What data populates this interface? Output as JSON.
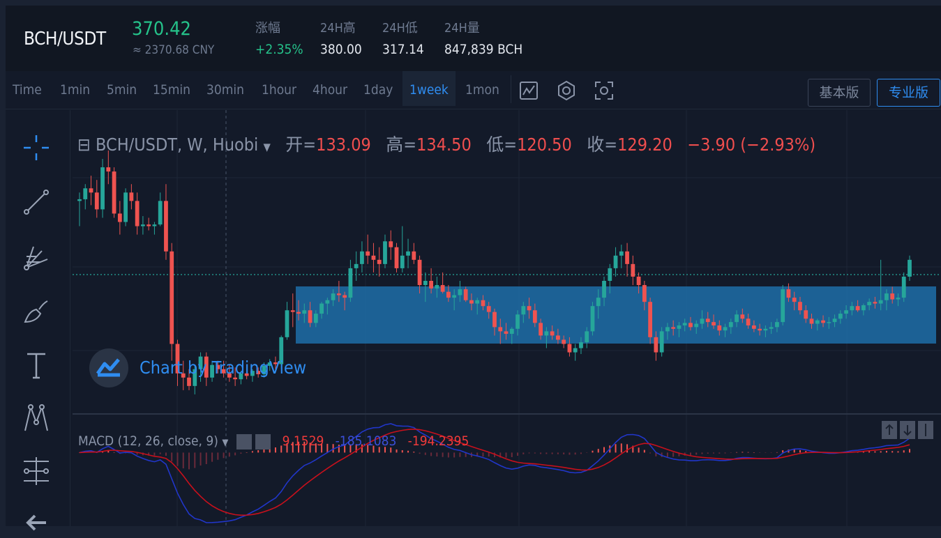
{
  "ticker": {
    "symbol": "BCH/USDT",
    "price": "370.42",
    "price_cny": "≈ 2370.68 CNY",
    "stats": [
      {
        "label": "涨幅",
        "value": "+2.35%",
        "up": true
      },
      {
        "label": "24H高",
        "value": "380.00"
      },
      {
        "label": "24H低",
        "value": "317.14"
      },
      {
        "label": "24H量",
        "value": "847,839 BCH"
      }
    ]
  },
  "toolbar": {
    "timeframes": [
      "Time",
      "1min",
      "5min",
      "15min",
      "30min",
      "1hour",
      "4hour",
      "1day",
      "1week",
      "1mon"
    ],
    "active_timeframe": "1week",
    "icons": [
      "indicator-icon",
      "settings-icon",
      "screenshot-icon"
    ],
    "basic_label": "基本版",
    "pro_label": "专业版",
    "active_version": "专业版"
  },
  "drawing_tools": [
    "crosshair-icon",
    "trend-line-icon",
    "fib-fan-icon",
    "brush-icon",
    "text-icon",
    "pattern-icon",
    "measure-icon",
    "back-arrow-icon"
  ],
  "legend": {
    "title": "BCH/USDT, W, Huobi",
    "open_label": "开=",
    "open": "133.09",
    "high_label": "高=",
    "high": "134.50",
    "low_label": "低=",
    "low": "120.50",
    "close_label": "收=",
    "close": "129.20",
    "change": "−3.90 (−2.93%)"
  },
  "watermark": "Chart by TradingView",
  "macd": {
    "label": "MACD (12, 26, close, 9)",
    "histogram": "9.1529",
    "macd": "-185.1083",
    "signal": "-194.2395"
  },
  "colors": {
    "up": "#26a69a",
    "down": "#ef5350",
    "accent": "#2f8df1",
    "zone": "#1e6fa8",
    "macd_line": "#2136c9",
    "signal_line": "#c8101c"
  },
  "chart_data": {
    "type": "candlestick",
    "interval": "1week",
    "series": [
      {
        "name": "BCH/USDT",
        "ohlc": [
          [
            280,
            290,
            250,
            282
          ],
          [
            282,
            300,
            270,
            295
          ],
          [
            295,
            310,
            275,
            290
          ],
          [
            290,
            305,
            260,
            270
          ],
          [
            270,
            330,
            260,
            320
          ],
          [
            320,
            340,
            300,
            315
          ],
          [
            315,
            320,
            260,
            265
          ],
          [
            265,
            280,
            240,
            255
          ],
          [
            255,
            295,
            250,
            290
          ],
          [
            290,
            300,
            270,
            280
          ],
          [
            280,
            290,
            240,
            250
          ],
          [
            250,
            262,
            240,
            252
          ],
          [
            252,
            260,
            245,
            250
          ],
          [
            250,
            255,
            240,
            252
          ],
          [
            252,
            290,
            250,
            280
          ],
          [
            280,
            300,
            210,
            220
          ],
          [
            220,
            230,
            90,
            110
          ],
          [
            110,
            115,
            60,
            75
          ],
          [
            75,
            90,
            55,
            70
          ],
          [
            70,
            80,
            55,
            60
          ],
          [
            60,
            85,
            50,
            80
          ],
          [
            80,
            100,
            65,
            95
          ],
          [
            95,
            100,
            60,
            70
          ],
          [
            70,
            90,
            65,
            85
          ],
          [
            85,
            90,
            75,
            80
          ],
          [
            80,
            90,
            70,
            75
          ],
          [
            75,
            85,
            65,
            70
          ],
          [
            70,
            82,
            60,
            68
          ],
          [
            68,
            78,
            62,
            75
          ],
          [
            75,
            85,
            68,
            72
          ],
          [
            72,
            80,
            65,
            78
          ],
          [
            78,
            82,
            70,
            74
          ],
          [
            74,
            88,
            70,
            84
          ],
          [
            84,
            92,
            78,
            88
          ],
          [
            88,
            95,
            80,
            86
          ],
          [
            86,
            120,
            80,
            118
          ],
          [
            118,
            160,
            115,
            150
          ],
          [
            150,
            170,
            130,
            148
          ],
          [
            148,
            162,
            138,
            146
          ],
          [
            146,
            158,
            135,
            150
          ],
          [
            150,
            160,
            130,
            135
          ],
          [
            135,
            150,
            130,
            146
          ],
          [
            146,
            160,
            140,
            158
          ],
          [
            158,
            165,
            145,
            162
          ],
          [
            162,
            175,
            155,
            170
          ],
          [
            170,
            185,
            160,
            168
          ],
          [
            168,
            172,
            150,
            165
          ],
          [
            165,
            210,
            160,
            200
          ],
          [
            200,
            220,
            185,
            205
          ],
          [
            205,
            232,
            195,
            220
          ],
          [
            220,
            240,
            205,
            215
          ],
          [
            215,
            230,
            195,
            210
          ],
          [
            210,
            225,
            190,
            205
          ],
          [
            205,
            240,
            200,
            232
          ],
          [
            232,
            245,
            210,
            225
          ],
          [
            225,
            230,
            195,
            200
          ],
          [
            200,
            250,
            195,
            215
          ],
          [
            215,
            235,
            200,
            220
          ],
          [
            220,
            230,
            205,
            210
          ],
          [
            210,
            215,
            170,
            180
          ],
          [
            180,
            195,
            160,
            185
          ],
          [
            185,
            200,
            170,
            176
          ],
          [
            176,
            190,
            165,
            180
          ],
          [
            180,
            195,
            170,
            172
          ],
          [
            172,
            180,
            160,
            165
          ],
          [
            165,
            175,
            150,
            168
          ],
          [
            168,
            185,
            160,
            175
          ],
          [
            175,
            178,
            160,
            162
          ],
          [
            162,
            170,
            150,
            158
          ],
          [
            158,
            165,
            145,
            162
          ],
          [
            162,
            168,
            150,
            155
          ],
          [
            155,
            160,
            140,
            148
          ],
          [
            148,
            152,
            120,
            130
          ],
          [
            130,
            140,
            110,
            125
          ],
          [
            125,
            135,
            115,
            122
          ],
          [
            122,
            130,
            110,
            128
          ],
          [
            128,
            150,
            120,
            145
          ],
          [
            145,
            160,
            135,
            155
          ],
          [
            155,
            165,
            140,
            150
          ],
          [
            150,
            158,
            130,
            135
          ],
          [
            135,
            140,
            115,
            120
          ],
          [
            120,
            130,
            105,
            125
          ],
          [
            125,
            132,
            115,
            120
          ],
          [
            120,
            128,
            110,
            115
          ],
          [
            115,
            120,
            105,
            110
          ],
          [
            110,
            118,
            95,
            100
          ],
          [
            100,
            110,
            90,
            105
          ],
          [
            105,
            118,
            98,
            112
          ],
          [
            112,
            130,
            105,
            125
          ],
          [
            125,
            160,
            120,
            155
          ],
          [
            155,
            175,
            140,
            165
          ],
          [
            165,
            190,
            155,
            185
          ],
          [
            185,
            205,
            170,
            200
          ],
          [
            200,
            225,
            190,
            215
          ],
          [
            215,
            228,
            200,
            220
          ],
          [
            220,
            230,
            190,
            205
          ],
          [
            205,
            215,
            180,
            190
          ],
          [
            190,
            195,
            170,
            180
          ],
          [
            180,
            185,
            150,
            160
          ],
          [
            160,
            165,
            110,
            118
          ],
          [
            118,
            125,
            90,
            100
          ],
          [
            100,
            130,
            95,
            125
          ],
          [
            125,
            135,
            115,
            130
          ],
          [
            130,
            138,
            120,
            128
          ],
          [
            128,
            136,
            118,
            132
          ],
          [
            132,
            140,
            125,
            135
          ],
          [
            135,
            142,
            126,
            130
          ],
          [
            130,
            138,
            122,
            134
          ],
          [
            134,
            150,
            128,
            140
          ],
          [
            140,
            148,
            130,
            136
          ],
          [
            136,
            145,
            128,
            132
          ],
          [
            132,
            138,
            120,
            126
          ],
          [
            126,
            134,
            118,
            130
          ],
          [
            130,
            140,
            122,
            136
          ],
          [
            136,
            150,
            130,
            145
          ],
          [
            145,
            152,
            135,
            140
          ],
          [
            140,
            146,
            128,
            132
          ],
          [
            132,
            138,
            124,
            128
          ],
          [
            128,
            134,
            120,
            126
          ],
          [
            126,
            132,
            118,
            128
          ],
          [
            128,
            136,
            122,
            130
          ],
          [
            130,
            140,
            124,
            136
          ],
          [
            136,
            180,
            132,
            175
          ],
          [
            175,
            182,
            160,
            165
          ],
          [
            165,
            172,
            150,
            160
          ],
          [
            160,
            166,
            145,
            150
          ],
          [
            150,
            156,
            135,
            140
          ],
          [
            140,
            146,
            128,
            134
          ],
          [
            134,
            140,
            126,
            138
          ],
          [
            138,
            144,
            130,
            135
          ],
          [
            135,
            142,
            128,
            136
          ],
          [
            136,
            145,
            130,
            140
          ],
          [
            140,
            150,
            134,
            146
          ],
          [
            146,
            156,
            140,
            150
          ],
          [
            150,
            160,
            144,
            155
          ],
          [
            155,
            162,
            148,
            150
          ],
          [
            150,
            158,
            144,
            156
          ],
          [
            156,
            164,
            150,
            160
          ],
          [
            160,
            166,
            152,
            158
          ],
          [
            158,
            210,
            150,
            162
          ],
          [
            162,
            175,
            150,
            170
          ],
          [
            170,
            178,
            158,
            163
          ],
          [
            163,
            170,
            155,
            165
          ],
          [
            165,
            195,
            160,
            190
          ],
          [
            190,
            215,
            185,
            210
          ]
        ]
      }
    ]
  }
}
